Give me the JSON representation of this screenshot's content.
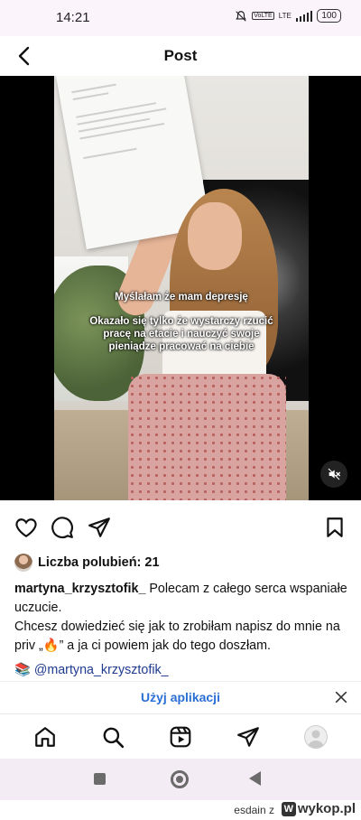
{
  "status_bar": {
    "time": "14:21",
    "battery": "100",
    "network": "LTE"
  },
  "header": {
    "title": "Post"
  },
  "video": {
    "caption_line1": "Myślałam że mam depresję",
    "caption_line2": "Okazało się tylko że wystarczy rzucić pracę na etacie i nauczyć swoje pieniądze pracować na ciebie"
  },
  "post": {
    "likes_text": "Liczba polubień: 21",
    "username": "martyna_krzysztofik_",
    "caption_part1": " Polecam z całego serca wspaniałe uczucie.",
    "caption_part2": "Chcesz dowiedzieć się jak to zrobiłam napisz do mnie na priv „🔥” a ja ci powiem jak do tego doszłam.",
    "mention_emoji": "📚",
    "mention": "@martyna_krzysztofik_"
  },
  "app_banner": {
    "label": "Użyj aplikacji"
  },
  "watermark": {
    "user": "esdain",
    "suffix": "z",
    "site": "wykop.pl"
  },
  "icons": [
    "back-icon",
    "heart-icon",
    "comment-icon",
    "share-icon",
    "bookmark-icon",
    "mute-icon",
    "home-icon",
    "search-icon",
    "reels-icon",
    "direct-icon",
    "profile-icon",
    "close-icon"
  ]
}
